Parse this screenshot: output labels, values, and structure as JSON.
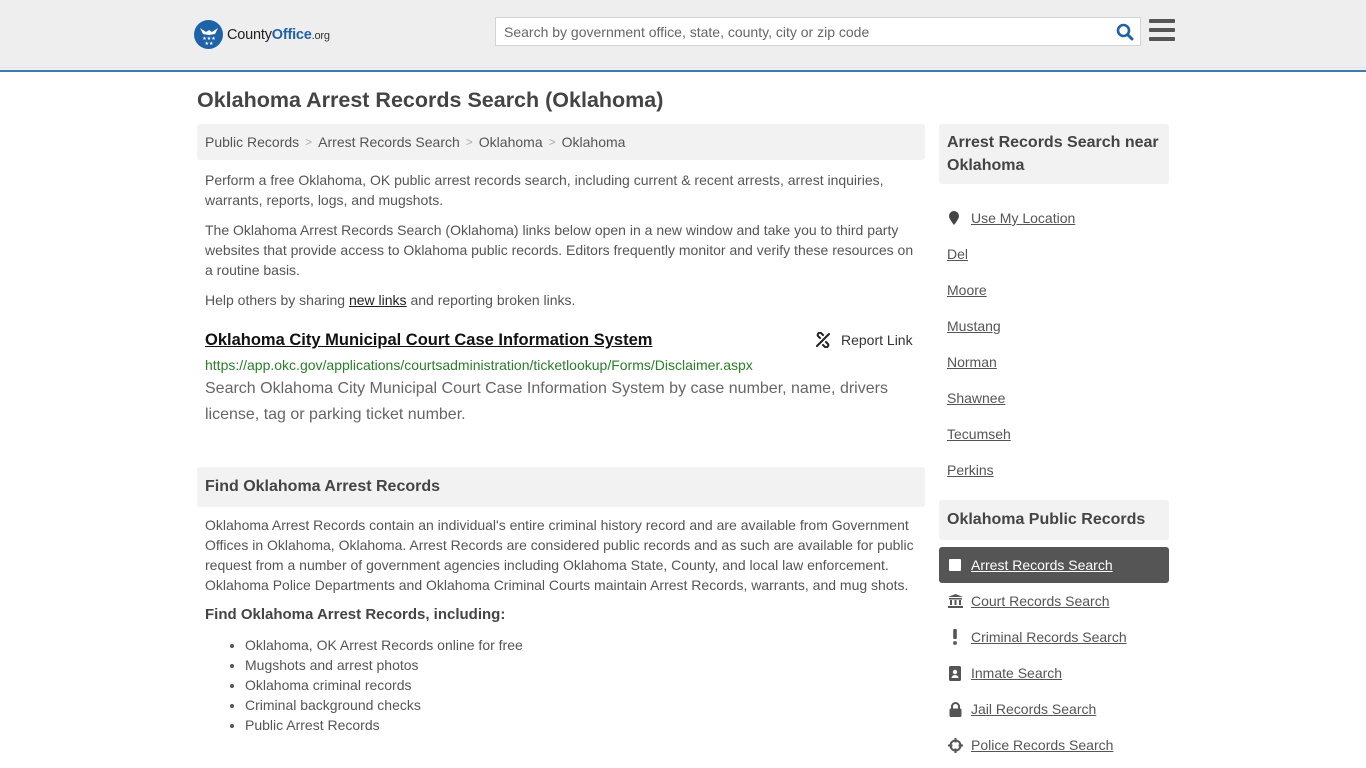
{
  "header": {
    "logo": {
      "brand_prefix": "County",
      "brand_main": "Office",
      "brand_suffix": ".org"
    },
    "search": {
      "placeholder": "Search by government office, state, county, city or zip code",
      "value": ""
    },
    "colors": {
      "brand_blue": "#1e63a8",
      "header_bg": "#eeeeee",
      "header_border": "#3a7bb0"
    }
  },
  "page": {
    "title": "Oklahoma Arrest Records Search (Oklahoma)",
    "breadcrumb": [
      "Public Records",
      "Arrest Records Search",
      "Oklahoma",
      "Oklahoma"
    ],
    "intro": {
      "p1": "Perform a free Oklahoma, OK public arrest records search, including current & recent arrests, arrest inquiries, warrants, reports, logs, and mugshots.",
      "p2": "The Oklahoma Arrest Records Search (Oklahoma) links below open in a new window and take you to third party websites that provide access to Oklahoma public records. Editors frequently monitor and verify these resources on a routine basis.",
      "p3_before": "Help others by sharing ",
      "p3_link": "new links",
      "p3_after": " and reporting broken links."
    },
    "results": [
      {
        "title": "Oklahoma City Municipal Court Case Information System",
        "url": "https://app.okc.gov/applications/courtsadministration/ticketlookup/Forms/Disclaimer.aspx",
        "description": "Search Oklahoma City Municipal Court Case Information System by case number, name, drivers license, tag or parking ticket number.",
        "report_label": "Report Link"
      }
    ],
    "find_section": {
      "heading": "Find Oklahoma Arrest Records",
      "body": "Oklahoma Arrest Records contain an individual's entire criminal history record and are available from Government Offices in Oklahoma, Oklahoma. Arrest Records are considered public records and as such are available for public request from a number of government agencies including Oklahoma State, County, and local law enforcement. Oklahoma Police Departments and Oklahoma Criminal Courts maintain Arrest Records, warrants, and mug shots.",
      "subheading": "Find Oklahoma Arrest Records, including:",
      "bullets": [
        "Oklahoma, OK Arrest Records online for free",
        "Mugshots and arrest photos",
        "Oklahoma criminal records",
        "Criminal background checks",
        "Public Arrest Records"
      ]
    }
  },
  "sidebar": {
    "near": {
      "heading": "Arrest Records Search near Oklahoma",
      "use_location": "Use My Location",
      "places": [
        "Del",
        "Moore",
        "Mustang",
        "Norman",
        "Shawnee",
        "Tecumseh",
        "Perkins"
      ]
    },
    "public_records": {
      "heading": "Oklahoma Public Records",
      "items": [
        {
          "label": "Arrest Records Search",
          "icon": "square-icon",
          "active": true
        },
        {
          "label": "Court Records Search",
          "icon": "courthouse-icon",
          "active": false
        },
        {
          "label": "Criminal Records Search",
          "icon": "exclamation-icon",
          "active": false
        },
        {
          "label": "Inmate Search",
          "icon": "id-badge-icon",
          "active": false
        },
        {
          "label": "Jail Records Search",
          "icon": "lock-icon",
          "active": false
        },
        {
          "label": "Police Records Search",
          "icon": "crosshairs-icon",
          "active": false
        }
      ]
    }
  }
}
